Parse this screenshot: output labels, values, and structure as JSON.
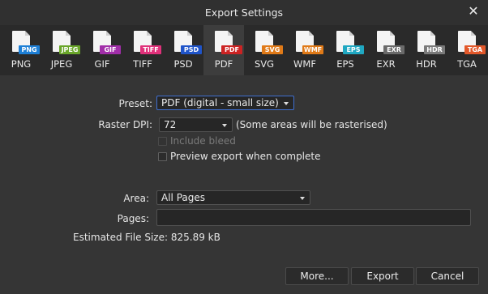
{
  "window": {
    "title": "Export Settings",
    "close_glyph": "✕"
  },
  "formats": [
    {
      "tag": "PNG",
      "label": "PNG",
      "color": "#1d7fd6"
    },
    {
      "tag": "JPEG",
      "label": "JPEG",
      "color": "#6aa62a"
    },
    {
      "tag": "GIF",
      "label": "GIF",
      "color": "#a12ea9"
    },
    {
      "tag": "TIFF",
      "label": "TIFF",
      "color": "#e0317a"
    },
    {
      "tag": "PSD",
      "label": "PSD",
      "color": "#1f54c9"
    },
    {
      "tag": "PDF",
      "label": "PDF",
      "color": "#cc2323"
    },
    {
      "tag": "SVG",
      "label": "SVG",
      "color": "#e07a18"
    },
    {
      "tag": "WMF",
      "label": "WMF",
      "color": "#e07a18"
    },
    {
      "tag": "EPS",
      "label": "EPS",
      "color": "#20a8c2"
    },
    {
      "tag": "EXR",
      "label": "EXR",
      "color": "#6a6a6a"
    },
    {
      "tag": "HDR",
      "label": "HDR",
      "color": "#7a7a7a"
    },
    {
      "tag": "TGA",
      "label": "TGA",
      "color": "#e2582a"
    }
  ],
  "active_format": "PDF",
  "form": {
    "preset_label": "Preset:",
    "preset_value": "PDF (digital - small size)",
    "dpi_label": "Raster DPI:",
    "dpi_value": "72",
    "dpi_note": "(Some areas will be rasterised)",
    "include_bleed": "Include bleed",
    "preview_export": "Preview export when complete",
    "area_label": "Area:",
    "area_value": "All Pages",
    "pages_label": "Pages:",
    "pages_value": "",
    "file_size_label": "Estimated File Size:",
    "file_size_value": "825.89 kB"
  },
  "buttons": {
    "more": "More...",
    "export": "Export",
    "cancel": "Cancel"
  }
}
